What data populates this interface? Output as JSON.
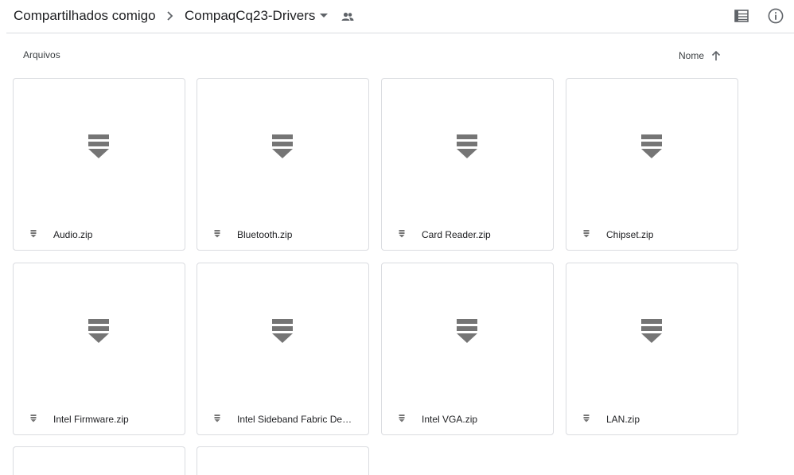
{
  "breadcrumb": {
    "root": "Compartilhados comigo",
    "current": "CompaqCq23-Drivers"
  },
  "icons": {
    "separator": "chevron-right-icon",
    "dropdown": "caret-down-icon",
    "shared": "people-icon",
    "view": "list-view-icon",
    "info": "info-icon",
    "sort": "arrow-up-icon",
    "file": "zip-file-icon"
  },
  "section": {
    "label": "Arquivos",
    "sort_label": "Nome"
  },
  "files": [
    {
      "name": "Audio.zip"
    },
    {
      "name": "Bluetooth.zip"
    },
    {
      "name": "Card Reader.zip"
    },
    {
      "name": "Chipset.zip"
    },
    {
      "name": "Intel Firmware.zip"
    },
    {
      "name": "Intel Sideband Fabric Devic..."
    },
    {
      "name": "Intel VGA.zip"
    },
    {
      "name": "LAN.zip"
    },
    {
      "name": ""
    },
    {
      "name": ""
    }
  ],
  "colors": {
    "icon_gray": "#757575",
    "border": "#dadce0",
    "text": "#202124"
  }
}
